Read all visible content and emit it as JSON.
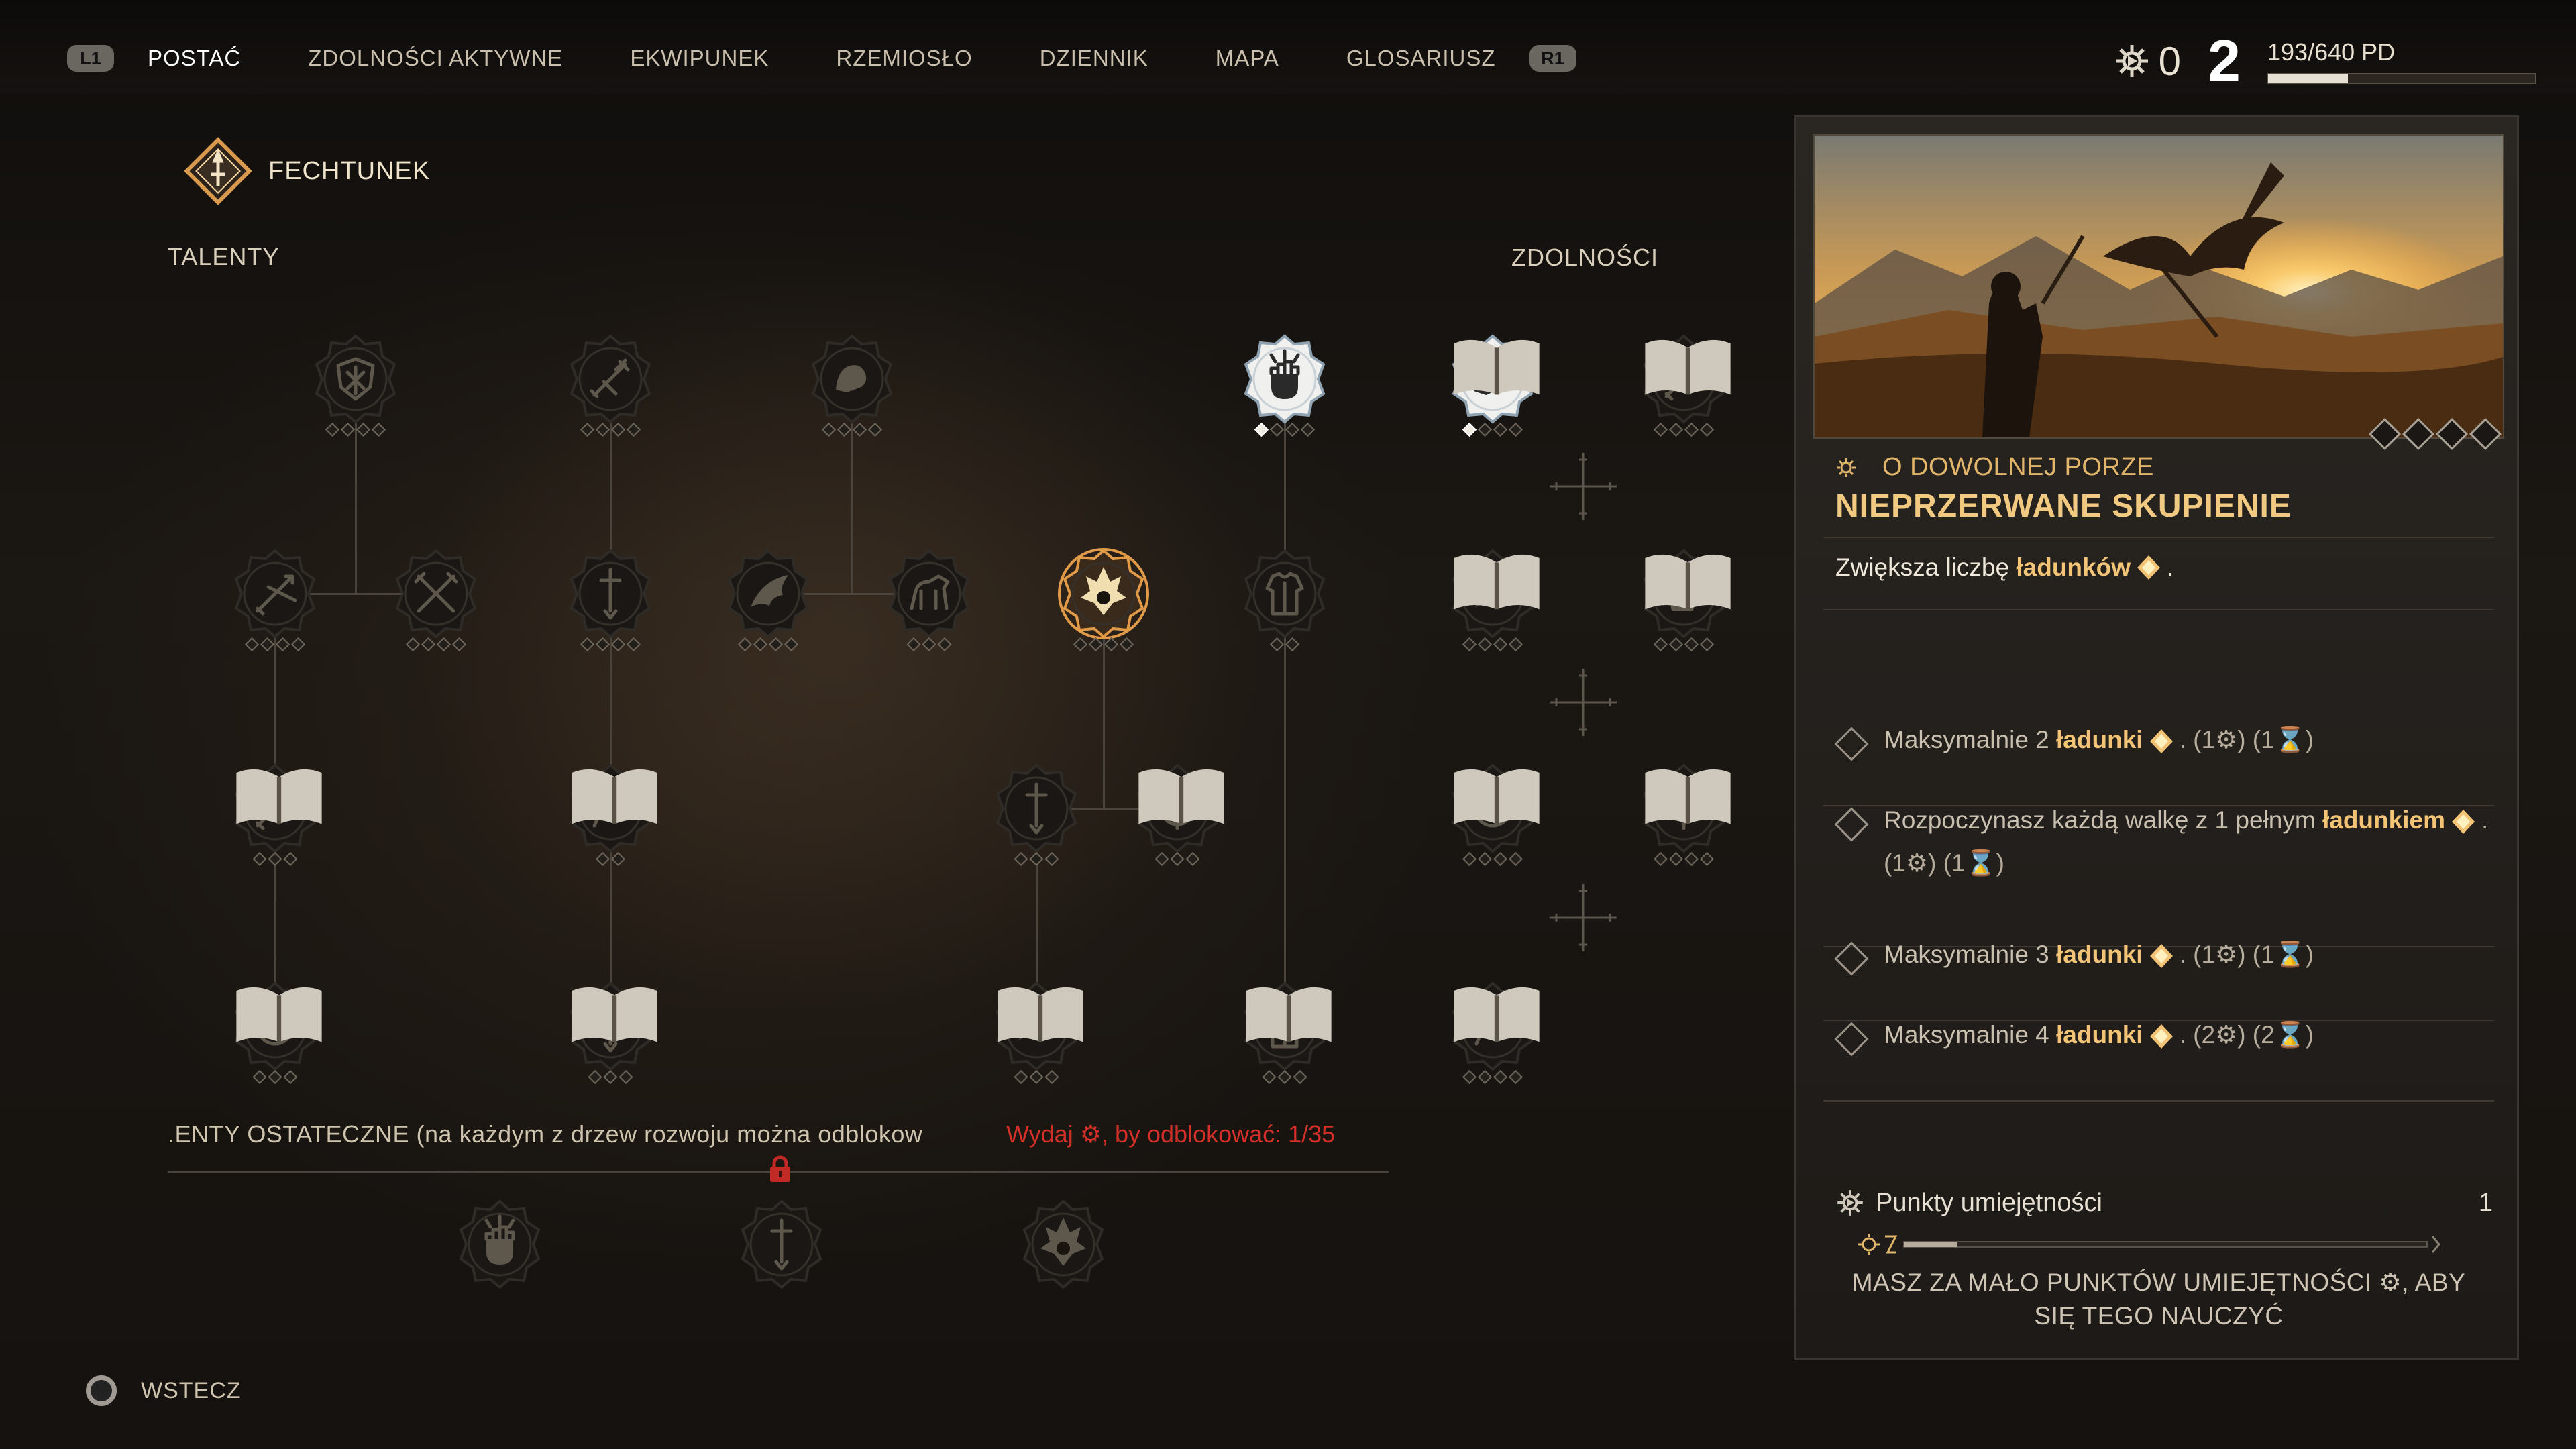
{
  "nav": {
    "left_bumper": "L1",
    "right_bumper": "R1",
    "tabs": [
      {
        "label": "POSTAĆ",
        "active": true
      },
      {
        "label": "ZDOLNOŚCI AKTYWNE",
        "active": false
      },
      {
        "label": "EKWIPUNEK",
        "active": false
      },
      {
        "label": "RZEMIOSŁO",
        "active": false
      },
      {
        "label": "DZIENNIK",
        "active": false
      },
      {
        "label": "MAPA",
        "active": false
      },
      {
        "label": "GLOSARIUSZ",
        "active": false
      }
    ]
  },
  "hud": {
    "skill_points": "0",
    "level": "2",
    "xp_text": "193/640 PD",
    "xp_fraction": 0.3
  },
  "tree": {
    "title": "FECHTUNEK",
    "talents_label": "TALENTY",
    "abilities_label": "ZDOLNOŚCI",
    "final_label": ".ENTY OSTATECZNE (na każdym z drzew rozwoju można odblokow",
    "final_req": "Wydaj ⚙, by odblokować: 1/35"
  },
  "panel": {
    "time_label": "O DOWOLNEJ PORZE",
    "title": "NIEPRZERWANE SKUPIENIE",
    "desc_prefix": "Zwiększa liczbę",
    "desc_keyword": "ładunków",
    "desc_suffix": ".",
    "ranks": [
      {
        "prefix": "Maksymalnie 2",
        "keyword": "ładunki",
        "cost": ". (1⚙) (1⌛)"
      },
      {
        "prefix": "Rozpoczynasz każdą walkę z 1 pełnym",
        "keyword": "ładunkiem",
        "cost": ". (1⚙) (1⌛)"
      },
      {
        "prefix": "Maksymalnie 3",
        "keyword": "ładunki",
        "cost": ". (1⚙) (1⌛)"
      },
      {
        "prefix": "Maksymalnie 4",
        "keyword": "ładunki",
        "cost": ". (2⚙) (2⌛)"
      }
    ],
    "skill_points_label": "Punkty umiejętności",
    "skill_points_value": "1",
    "warning_line1": "MASZ ZA MAŁO PUNKTÓW UMIEJĘTNOŚCI ⚙, ABY",
    "warning_line2": "SIĘ TEGO NAUCZYĆ"
  },
  "footer": {
    "back_label": "WSTECZ"
  },
  "colors": {
    "accent": "#f1c981",
    "warning": "#d3302a"
  }
}
